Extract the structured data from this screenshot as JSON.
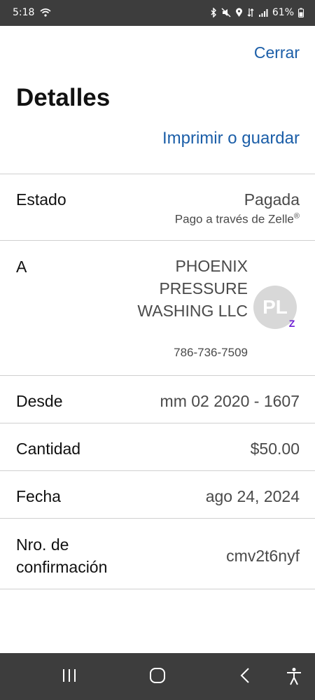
{
  "status_bar": {
    "time": "5:18",
    "battery": "61%"
  },
  "header": {
    "close_label": "Cerrar",
    "title": "Detalles",
    "print_label": "Imprimir o guardar"
  },
  "details": {
    "status": {
      "label": "Estado",
      "value": "Pagada",
      "sub_value": "Pago a través de Zelle"
    },
    "recipient": {
      "label": "A",
      "name": "PHOENIX PRESSURE WASHING LLC",
      "phone": "786-736-7509",
      "avatar_initials": "PL",
      "badge": "Z"
    },
    "from": {
      "label": "Desde",
      "value": "mm 02 2020 - 1607"
    },
    "amount": {
      "label": "Cantidad",
      "value": "$50.00"
    },
    "date": {
      "label": "Fecha",
      "value": "ago 24, 2024"
    },
    "confirmation": {
      "label": "Nro. de confirmación",
      "value": "cmv2t6nyf"
    }
  },
  "colors": {
    "link": "#1b5ea8",
    "zelle_purple": "#6d1ed4",
    "system_bar": "#3d3d3d"
  },
  "icons": {
    "status_bar": [
      "wifi-icon",
      "bluetooth-icon",
      "mute-icon",
      "location-icon",
      "data-icon",
      "signal-icon",
      "battery-icon"
    ],
    "nav_bar": [
      "recent-apps-icon",
      "home-icon",
      "back-icon",
      "accessibility-icon"
    ]
  }
}
